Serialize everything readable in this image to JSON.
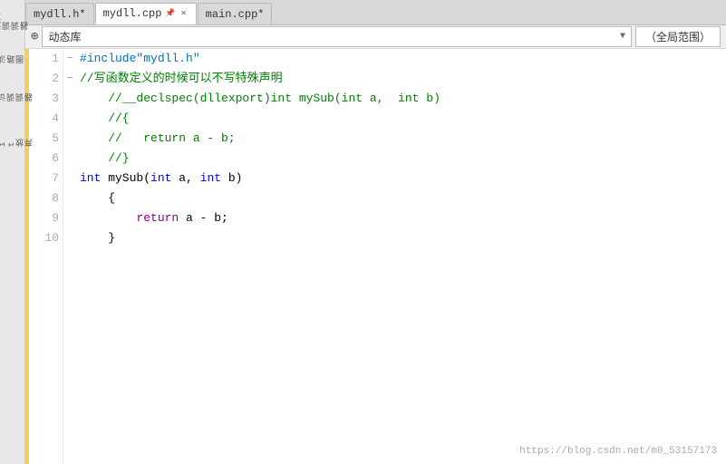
{
  "sidebar": {
    "items": [
      {
        "label": "浏览调调器",
        "id": "browser"
      },
      {
        "label": "淡路图",
        "id": "map"
      },
      {
        "label": "调试调调器",
        "id": "debugger"
      },
      {
        "label": "Git\n放\n弃",
        "id": "git"
      }
    ]
  },
  "tabs": [
    {
      "label": "mydll.h*",
      "active": false,
      "pinned": false,
      "modified": true
    },
    {
      "label": "mydll.cpp",
      "active": true,
      "pinned": true,
      "modified": false
    },
    {
      "label": "main.cpp*",
      "active": false,
      "pinned": false,
      "modified": true
    }
  ],
  "toolbar": {
    "dropdown_label": "动态库",
    "scope_label": "（全局范围）"
  },
  "code": {
    "lines": [
      {
        "num": 1,
        "fold": "",
        "content": "#include\"mydll.h\"",
        "tokens": [
          {
            "text": "#include\"mydll.h\"",
            "class": "c-preproc"
          }
        ]
      },
      {
        "num": 2,
        "fold": "−",
        "content": "//写函数定义的时候可以不写特殊声明",
        "tokens": [
          {
            "text": "//写函数定义的时候可以不写特殊声明",
            "class": "c-comment"
          }
        ]
      },
      {
        "num": 3,
        "fold": "",
        "content": "    //__declspec(dllexport)int mySub(int a,  int b)",
        "tokens": [
          {
            "text": "    //__declspec(dllexport)int mySub(int a,  int b)",
            "class": "c-comment"
          }
        ]
      },
      {
        "num": 4,
        "fold": "",
        "content": "    //{",
        "tokens": [
          {
            "text": "    //{",
            "class": "c-comment"
          }
        ]
      },
      {
        "num": 5,
        "fold": "",
        "content": "    //   return a - b;",
        "tokens": [
          {
            "text": "    //   return a - b;",
            "class": "c-comment"
          }
        ]
      },
      {
        "num": 6,
        "fold": "",
        "content": "    //}",
        "tokens": [
          {
            "text": "    //}",
            "class": "c-comment"
          }
        ]
      },
      {
        "num": 7,
        "fold": "−",
        "content": "int mySub(int a, int b)",
        "tokens": [
          {
            "text": "int",
            "class": "c-type"
          },
          {
            "text": " mySub(",
            "class": "c-default"
          },
          {
            "text": "int",
            "class": "c-type"
          },
          {
            "text": " a, ",
            "class": "c-default"
          },
          {
            "text": "int",
            "class": "c-type"
          },
          {
            "text": " b)",
            "class": "c-default"
          }
        ]
      },
      {
        "num": 8,
        "fold": "",
        "content": "    {",
        "tokens": [
          {
            "text": "    {",
            "class": "c-default"
          }
        ]
      },
      {
        "num": 9,
        "fold": "",
        "content": "        return a - b;",
        "tokens": [
          {
            "text": "        ",
            "class": "c-default"
          },
          {
            "text": "return",
            "class": "c-return-kw"
          },
          {
            "text": " a - b;",
            "class": "c-default"
          }
        ]
      },
      {
        "num": 10,
        "fold": "",
        "content": "    }",
        "tokens": [
          {
            "text": "    }",
            "class": "c-default"
          }
        ]
      }
    ]
  },
  "watermark": "https://blog.csdn.net/m0_53157173"
}
